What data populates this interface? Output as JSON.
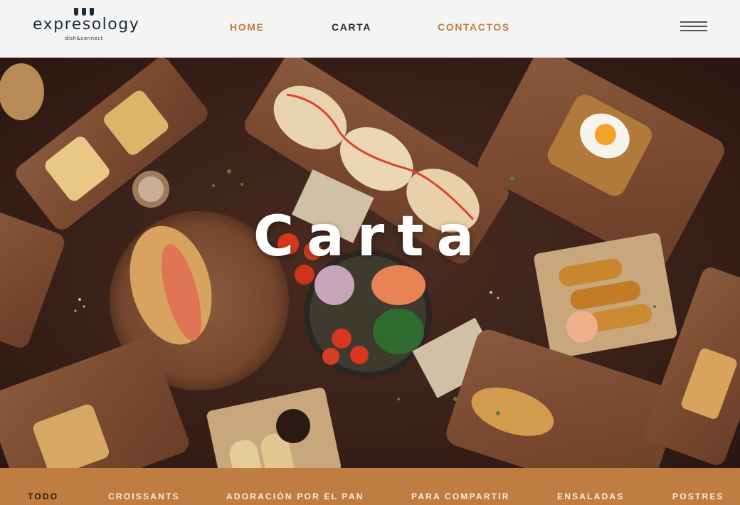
{
  "brand": {
    "name": "expresology",
    "tagline": "dish&connect"
  },
  "nav": {
    "home": "HOME",
    "carta": "CARTA",
    "contactos": "CONTACTOS"
  },
  "hero": {
    "title": "Carta"
  },
  "categories": [
    "TODO",
    "CROISSANTS",
    "ADORACIÓN POR EL PAN",
    "PARA COMPARTIR",
    "ENSALADAS",
    "POSTRES"
  ],
  "colors": {
    "accent": "#bf7d42",
    "nav_link": "#c0803f",
    "text_dark": "#1e2a3c",
    "header_bg": "#f4f4f4"
  },
  "icons": [
    "menu-icon"
  ]
}
